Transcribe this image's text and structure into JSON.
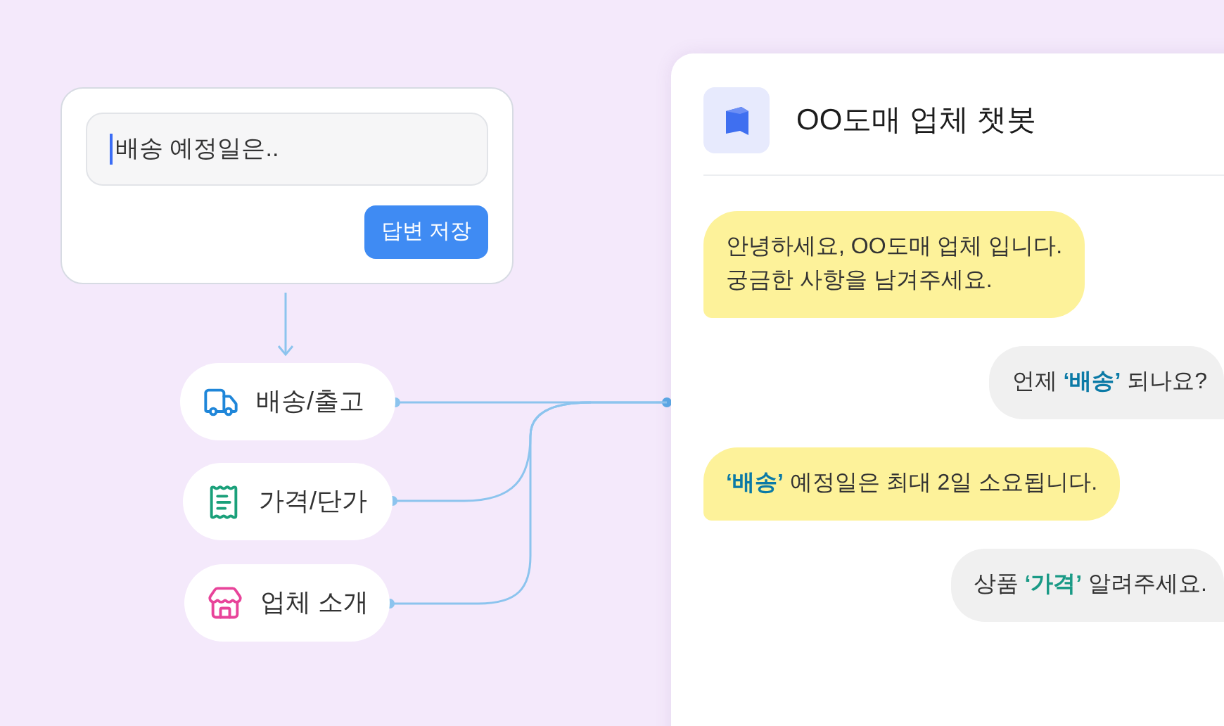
{
  "editor": {
    "answer_field": {
      "value": "배송 예정일은.."
    },
    "save_button": "답변 저장"
  },
  "topics": [
    {
      "kind": "truck",
      "label": "배송/출고",
      "color": "#1f86d9"
    },
    {
      "kind": "receipt",
      "label": "가격/단가",
      "color": "#1aa07a"
    },
    {
      "kind": "store",
      "label": "업체 소개",
      "color": "#e8449a"
    }
  ],
  "chat": {
    "title": "OO도매 업체 챗봇",
    "messages": [
      {
        "kind": "bot",
        "lines": [
          [
            {
              "text": "안녕하세요, OO도매 업체 입니다."
            }
          ],
          [
            {
              "text": "궁금한 사항을 남겨주세요."
            }
          ]
        ]
      },
      {
        "kind": "user",
        "lines": [
          [
            {
              "text": "언제 "
            },
            {
              "text": "‘배송’",
              "color": "#0b7aa6"
            },
            {
              "text": " 되나요?"
            }
          ]
        ]
      },
      {
        "kind": "bot",
        "lines": [
          [
            {
              "text": "‘배송’",
              "color": "#0b7aa6"
            },
            {
              "text": " 예정일은 최대 2일 소요됩니다."
            }
          ]
        ]
      },
      {
        "kind": "user",
        "lines": [
          [
            {
              "text": "상품 "
            },
            {
              "text": "‘가격’",
              "color": "#1a9a86"
            },
            {
              "text": " 알려주세요."
            }
          ]
        ]
      }
    ]
  }
}
